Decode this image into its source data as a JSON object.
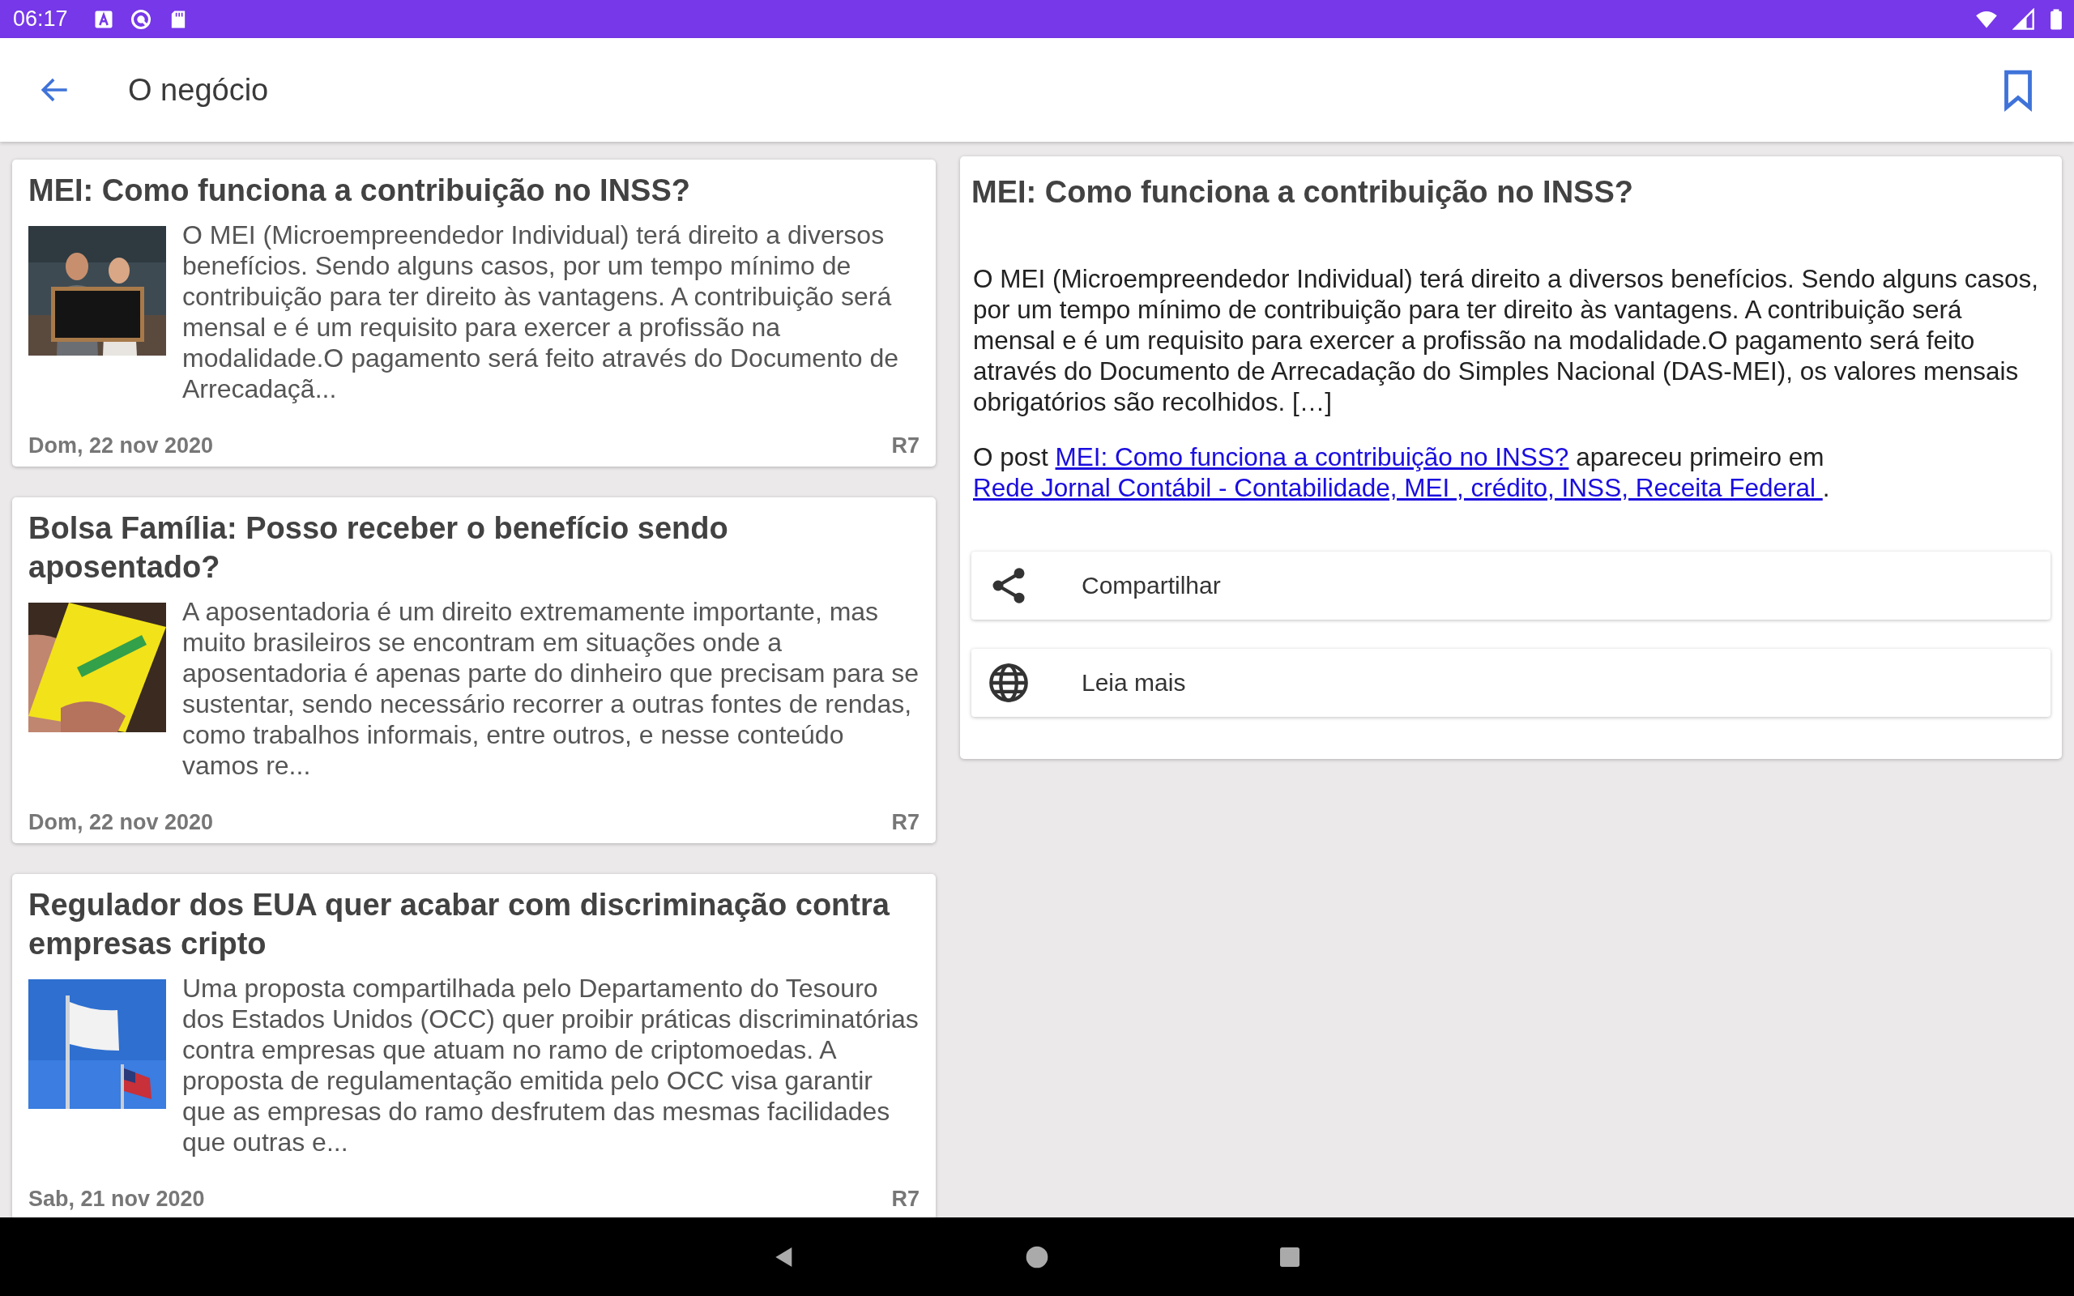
{
  "status_bar": {
    "time": "06:17"
  },
  "app_bar": {
    "title": "O negócio",
    "bookmarked": false
  },
  "articles": [
    {
      "title": "MEI: Como funciona a contribuição no INSS?",
      "summary": "O MEI (Microempreendedor Individual) terá direito a diversos benefícios. Sendo alguns casos, por um tempo mínimo de contribuição para ter direito às vantagens. A contribuição será mensal e é um requisito para exercer a profissão na modalidade.O pagamento será feito através do Documento de Arrecadaçã...",
      "date": "Dom, 22 nov 2020",
      "source": "R7"
    },
    {
      "title": "Bolsa Família: Posso receber o benefício sendo aposentado?",
      "summary": "A aposentadoria é um direito extremamente importante, mas muito brasileiros se encontram em situações onde a aposentadoria é apenas parte do dinheiro que precisam para se sustentar, sendo necessário recorrer a outras fontes de rendas, como trabalhos informais, entre outros, e nesse conteúdo vamos re...",
      "date": "Dom, 22 nov 2020",
      "source": "R7"
    },
    {
      "title": "Regulador dos EUA quer acabar com discriminação contra empresas cripto",
      "summary": "Uma proposta compartilhada pelo Departamento do Tesouro dos Estados Unidos (OCC) quer proibir práticas discriminatórias contra empresas que atuam no ramo de criptomoedas. A proposta de regulamentação emitida pelo OCC visa garantir que as empresas do ramo desfrutem das mesmas facilidades que outras e...",
      "date": "Sab, 21 nov 2020",
      "source": "R7"
    }
  ],
  "detail": {
    "title": "MEI: Como funciona a contribuição no INSS?",
    "body": "O MEI (Microempreendedor Individual) terá direito a diversos benefícios. Sendo alguns casos, por um tempo mínimo de contribuição para ter direito às vantagens. A contribuição será mensal e é um requisito para exercer a profissão na modalidade.O pagamento será feito através do Documento de Arrecadação do Simples Nacional (DAS-MEI), os valores mensais obrigatórios são recolhidos. […]",
    "footer": [
      {
        "kind": "text",
        "text": "O post "
      },
      {
        "kind": "link",
        "text": "MEI: Como funciona a contribuição no INSS?"
      },
      {
        "kind": "text",
        "text": " apareceu primeiro em "
      },
      {
        "kind": "link",
        "text": "Rede Jornal Contábil - Contabilidade, MEI , crédito, INSS, Receita Federal "
      },
      {
        "kind": "text",
        "text": "."
      }
    ],
    "actions": [
      {
        "kind": "share",
        "label": "Compartilhar"
      },
      {
        "kind": "web",
        "label": "Leia mais"
      }
    ]
  }
}
